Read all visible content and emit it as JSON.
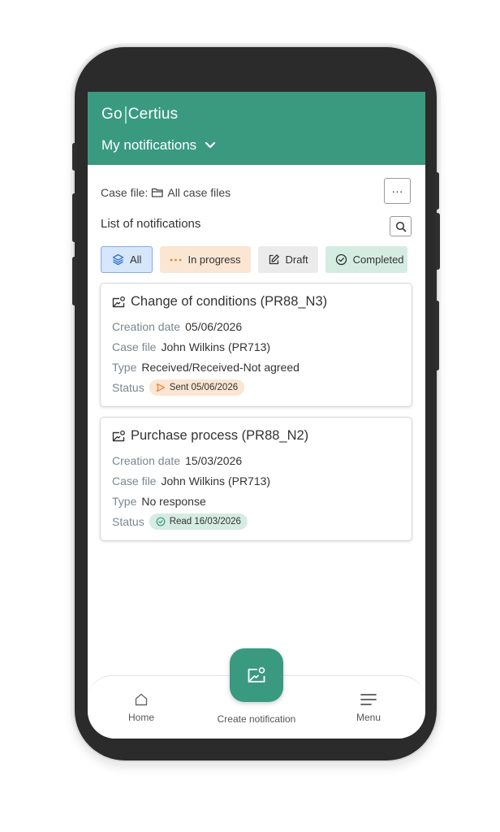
{
  "app": {
    "logo_left": "Go",
    "logo_right": "Certius",
    "section_title": "My notifications"
  },
  "filter_bar": {
    "case_file_label": "Case file:",
    "case_file_value": "All case files",
    "more_label": "···"
  },
  "list": {
    "title": "List of notifications",
    "filters": [
      {
        "label": "All",
        "icon": "layers-icon",
        "selected": true
      },
      {
        "label": "In progress",
        "icon": "dots-icon"
      },
      {
        "label": "Draft",
        "icon": "edit-icon"
      },
      {
        "label": "Completed",
        "icon": "check-circle-icon"
      }
    ],
    "notifications": [
      {
        "title": "Change of conditions (PR88_N3)",
        "creation_date_label": "Creation date",
        "creation_date": "05/06/2026",
        "case_file_label": "Case file",
        "case_file": "John Wilkins (PR713)",
        "type_label": "Type",
        "type": "Received/Received-Not agreed",
        "status_label": "Status",
        "status": "Sent 05/06/2026",
        "status_color": "#f08a3c"
      },
      {
        "title": "Purchase process (PR88_N2)",
        "creation_date_label": "Creation date",
        "creation_date": "15/03/2026",
        "case_file_label": "Case file",
        "case_file": "John Wilkins (PR713)",
        "type_label": "Type",
        "type": "No response",
        "status_label": "Status",
        "status": "Read 16/03/2026",
        "status_color": "#3a9a80"
      }
    ]
  },
  "bottom_nav": {
    "home": "Home",
    "create": "Create notification",
    "menu": "Menu"
  },
  "colors": {
    "brand": "#3a9a80",
    "chip_all": "#d6e6fb",
    "chip_progress": "#fbe6d3",
    "chip_draft": "#ebebeb",
    "chip_completed": "#d5ece3"
  }
}
